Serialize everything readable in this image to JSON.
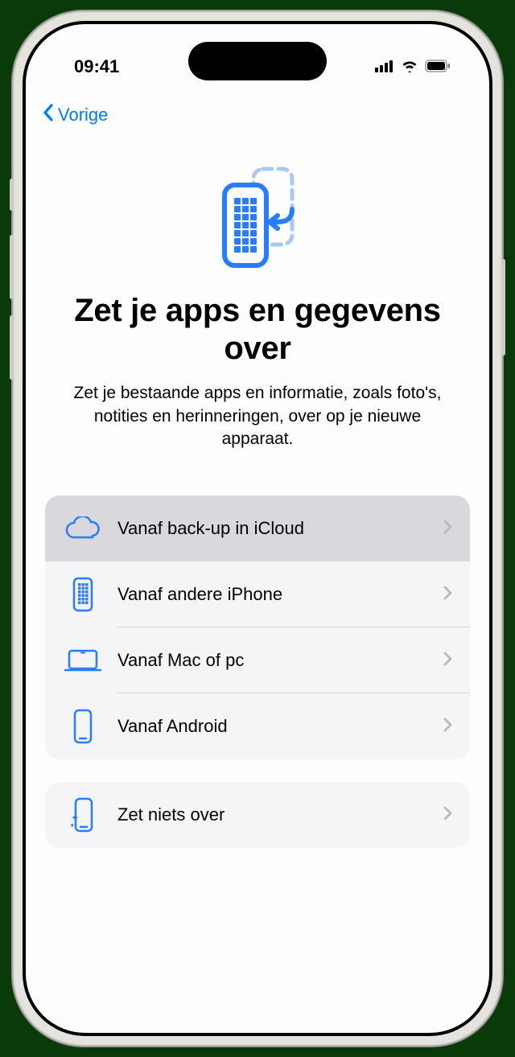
{
  "status": {
    "time": "09:41"
  },
  "nav": {
    "back_label": "Vorige"
  },
  "hero": {
    "title": "Zet je apps en gegevens over",
    "subtitle": "Zet je bestaande apps en informatie, zoals foto's, notities en herinneringen, over op je nieuwe apparaat."
  },
  "options": {
    "icloud": "Vanaf back-up in iCloud",
    "iphone": "Vanaf andere iPhone",
    "mac": "Vanaf Mac of pc",
    "android": "Vanaf Android",
    "none": "Zet niets over"
  },
  "colors": {
    "accent": "#007aff"
  }
}
